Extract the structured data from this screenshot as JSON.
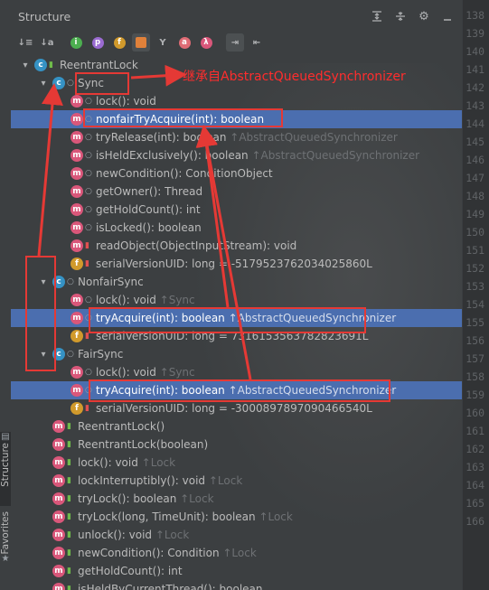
{
  "panel": {
    "title": "Structure",
    "title_actions": [
      "expand-all-icon",
      "collapse-all-icon",
      "gear-icon",
      "minimize-icon"
    ],
    "toolbar": [
      {
        "name": "sort-visibility-icon",
        "glyph": "↓≡",
        "on": false
      },
      {
        "name": "sort-alpha-icon",
        "glyph": "↓a",
        "on": false
      },
      {
        "name": "show-inherited-icon",
        "glyph": "i",
        "on": false,
        "color": "#4caf50"
      },
      {
        "name": "show-properties-icon",
        "glyph": "p",
        "on": false,
        "color": "#9a6bd1"
      },
      {
        "name": "show-fields-icon",
        "glyph": "f",
        "on": false,
        "color": "#d19a2c"
      },
      {
        "name": "show-non-public-icon",
        "glyph": "",
        "on": true,
        "color": "#e0813a"
      },
      {
        "name": "show-anonymous-icon",
        "glyph": "Y",
        "on": false
      },
      {
        "name": "show-anonymous-classes-icon",
        "glyph": "a",
        "on": false,
        "color": "#e06c75"
      },
      {
        "name": "show-lambdas-icon",
        "glyph": "λ",
        "on": false,
        "color": "#d9577a"
      },
      {
        "name": "autoscroll-to-source-icon",
        "glyph": "⇥",
        "on": true
      },
      {
        "name": "autoscroll-from-source-icon",
        "glyph": "⇤",
        "on": false
      }
    ]
  },
  "tree": [
    {
      "indent": 0,
      "arrow": "▾",
      "icon": "c",
      "mod": "pub",
      "text": "ReentrantLock"
    },
    {
      "indent": 1,
      "arrow": "▾",
      "icon": "c",
      "mod": "def",
      "text": "Sync"
    },
    {
      "indent": 2,
      "icon": "m",
      "mod": "def",
      "text": "lock(): void"
    },
    {
      "indent": 2,
      "icon": "m",
      "mod": "def",
      "text": "nonfairTryAcquire(int): boolean",
      "selected": true
    },
    {
      "indent": 2,
      "icon": "m",
      "mod": "def",
      "text": "tryRelease(int): boolean",
      "inherited": "↑AbstractQueuedSynchronizer"
    },
    {
      "indent": 2,
      "icon": "m",
      "mod": "def",
      "text": "isHeldExclusively(): boolean",
      "inherited": "↑AbstractQueuedSynchronizer"
    },
    {
      "indent": 2,
      "icon": "m",
      "mod": "def",
      "text": "newCondition(): ConditionObject"
    },
    {
      "indent": 2,
      "icon": "m",
      "mod": "def",
      "text": "getOwner(): Thread"
    },
    {
      "indent": 2,
      "icon": "m",
      "mod": "def",
      "text": "getHoldCount(): int"
    },
    {
      "indent": 2,
      "icon": "m",
      "mod": "def",
      "text": "isLocked(): boolean"
    },
    {
      "indent": 2,
      "icon": "m",
      "mod": "priv",
      "text": "readObject(ObjectInputStream): void"
    },
    {
      "indent": 2,
      "icon": "f",
      "mod": "priv",
      "text": "serialVersionUID: long = -5179523762034025860L"
    },
    {
      "indent": 1,
      "arrow": "▾",
      "icon": "c",
      "mod": "def",
      "text": "NonfairSync"
    },
    {
      "indent": 2,
      "icon": "m",
      "mod": "def",
      "text": "lock(): void",
      "inherited": "↑Sync"
    },
    {
      "indent": 2,
      "icon": "m",
      "mod": "def",
      "text": "tryAcquire(int): boolean",
      "inherited": "↑AbstractQueuedSynchronizer",
      "selected": true
    },
    {
      "indent": 2,
      "icon": "f",
      "mod": "priv",
      "text": "serialVersionUID: long = 7316153563782823691L"
    },
    {
      "indent": 1,
      "arrow": "▾",
      "icon": "c",
      "mod": "def",
      "text": "FairSync"
    },
    {
      "indent": 2,
      "icon": "m",
      "mod": "def",
      "text": "lock(): void",
      "inherited": "↑Sync"
    },
    {
      "indent": 2,
      "icon": "m",
      "mod": "def",
      "text": "tryAcquire(int): boolean",
      "inherited": "↑AbstractQueuedSynchronizer",
      "selected": true
    },
    {
      "indent": 2,
      "icon": "f",
      "mod": "priv",
      "text": "serialVersionUID: long = -3000897897090466540L"
    },
    {
      "indent": 1,
      "icon": "m",
      "mod": "pub",
      "text": "ReentrantLock()"
    },
    {
      "indent": 1,
      "icon": "m",
      "mod": "pub",
      "text": "ReentrantLock(boolean)"
    },
    {
      "indent": 1,
      "icon": "m",
      "mod": "pub",
      "text": "lock(): void",
      "inherited": "↑Lock"
    },
    {
      "indent": 1,
      "icon": "m",
      "mod": "pub",
      "text": "lockInterruptibly(): void",
      "inherited": "↑Lock"
    },
    {
      "indent": 1,
      "icon": "m",
      "mod": "pub",
      "text": "tryLock(): boolean",
      "inherited": "↑Lock"
    },
    {
      "indent": 1,
      "icon": "m",
      "mod": "pub",
      "text": "tryLock(long, TimeUnit): boolean",
      "inherited": "↑Lock"
    },
    {
      "indent": 1,
      "icon": "m",
      "mod": "pub",
      "text": "unlock(): void",
      "inherited": "↑Lock"
    },
    {
      "indent": 1,
      "icon": "m",
      "mod": "pub",
      "text": "newCondition(): Condition",
      "inherited": "↑Lock"
    },
    {
      "indent": 1,
      "icon": "m",
      "mod": "pub",
      "text": "getHoldCount(): int"
    },
    {
      "indent": 1,
      "icon": "m",
      "mod": "pub",
      "text": "isHeldByCurrentThread(): boolean"
    }
  ],
  "gutter": {
    "line_numbers": [
      "138",
      "139",
      "140",
      "141",
      "142",
      "143",
      "144",
      "145",
      "146",
      "147",
      "148",
      "149",
      "150",
      "151",
      "152",
      "153",
      "154",
      "155",
      "156",
      "157",
      "158",
      "159",
      "160",
      "161",
      "162",
      "163",
      "164",
      "165",
      "166"
    ]
  },
  "side_stripe": {
    "tabs": [
      "Structure",
      "Favorites"
    ]
  },
  "annotation": {
    "text": "继承自AbstractQueuedSynchronizer",
    "color": "#ff2d2d"
  }
}
